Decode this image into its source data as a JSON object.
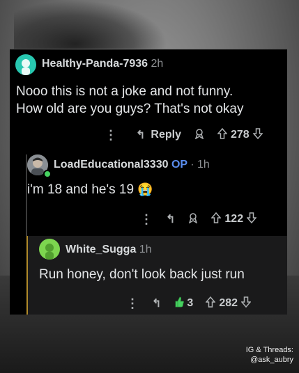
{
  "comments": [
    {
      "username": "Healthy-Panda-7936",
      "time": "2h",
      "text_line1": "Nooo this is not a joke and not funny.",
      "text_line2": "How old are you guys? That's not okay",
      "reply_label": "Reply",
      "votes": "278"
    },
    {
      "username": "LoadEducational3330",
      "op_badge": "OP",
      "separator": "·",
      "time": "1h",
      "text": "i'm 18 and he's 19",
      "emoji": "😭",
      "votes": "122"
    },
    {
      "username": "White_Sugga",
      "time": "1h",
      "text": "Run honey, don't look back just run",
      "award_count": "3",
      "votes": "282"
    }
  ],
  "footer": {
    "line1": "IG & Threads:",
    "line2": "@ask_aubry"
  },
  "colors": {
    "card_bg": "#000000",
    "reply_bg": "#1a1a1b",
    "op_blue": "#5a8dee",
    "avatar_teal": "#28c7b0",
    "avatar_green": "#7dd64f",
    "award_green": "#46d160",
    "thread_gold": "#b08a2a"
  }
}
